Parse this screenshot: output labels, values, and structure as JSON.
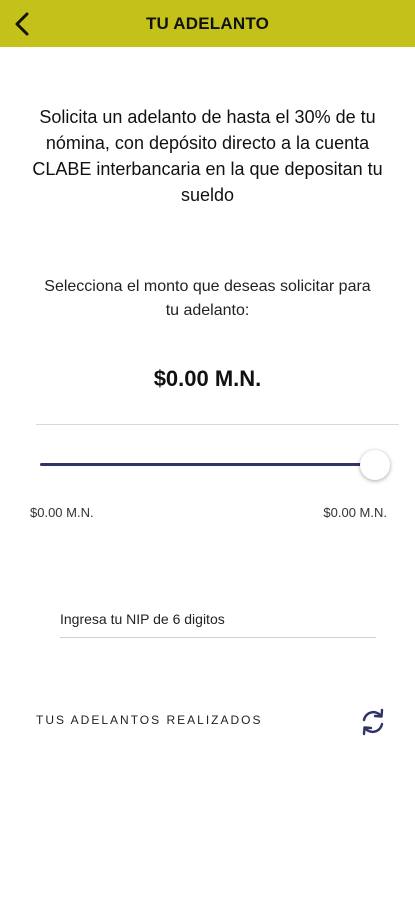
{
  "header": {
    "title": "TU ADELANTO",
    "back_icon": "chevron-left-icon",
    "background_color": "#c4c21a"
  },
  "intro": {
    "text": "Solicita un adelanto de hasta el 30% de tu nómina, con depósito directo a la cuenta CLABE interbancaria en la que depositan tu sueldo"
  },
  "amount_selector": {
    "prompt": "Selecciona el monto que deseas solicitar para tu adelanto:",
    "selected_amount": "$0.00 M.N.",
    "slider_level": 1.0,
    "track_color": "#2f3466",
    "min_label": "$0.00 M.N.",
    "max_label": "$0.00 M.N."
  },
  "nip": {
    "placeholder": "Ingresa tu NIP de 6 digitos",
    "value": ""
  },
  "history": {
    "label": "TUS ADELANTOS REALIZADOS",
    "refresh_icon": "refresh-icon",
    "icon_color": "#2f3466"
  }
}
